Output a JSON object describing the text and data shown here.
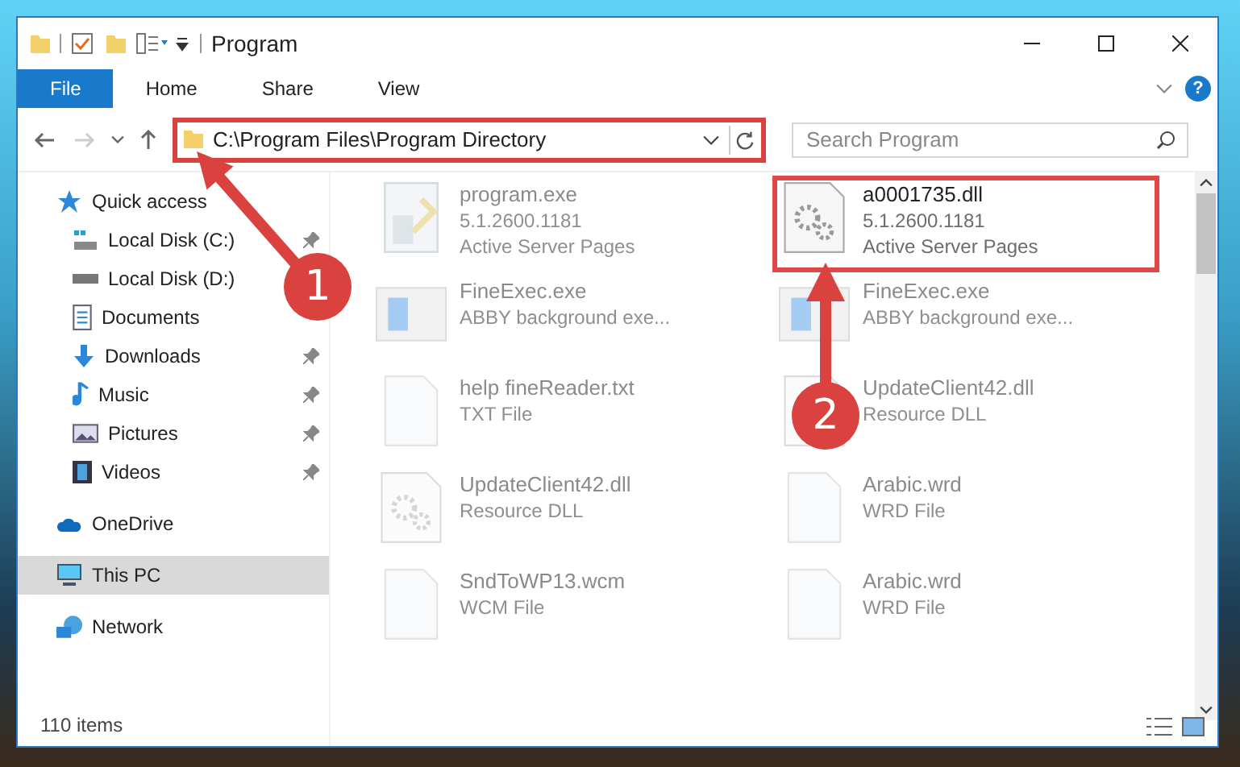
{
  "window": {
    "title": "Program"
  },
  "ribbon_tabs": [
    {
      "label": "File",
      "selected": true
    },
    {
      "label": "Home",
      "selected": false
    },
    {
      "label": "Share",
      "selected": false
    },
    {
      "label": "View",
      "selected": false
    }
  ],
  "help": "?",
  "address": {
    "path": "C:\\Program Files\\Program Directory",
    "highlighted": true
  },
  "search": {
    "placeholder": "Search Program"
  },
  "sidebar": {
    "items": [
      {
        "label": "Quick access",
        "kind": "star",
        "selected": false,
        "children": [
          {
            "label": "Local Disk (C:)",
            "kind": "drive-win",
            "pinned": true
          },
          {
            "label": "Local Disk (D:)",
            "kind": "drive"
          },
          {
            "label": "Documents",
            "kind": "documents",
            "pinned": false
          },
          {
            "label": "Downloads",
            "kind": "download",
            "pinned": true
          },
          {
            "label": "Music",
            "kind": "music",
            "pinned": true
          },
          {
            "label": "Pictures",
            "kind": "pictures",
            "pinned": true
          },
          {
            "label": "Videos",
            "kind": "videos",
            "pinned": true
          }
        ]
      },
      {
        "label": "OneDrive",
        "kind": "cloud",
        "selected": false
      },
      {
        "label": "This PC",
        "kind": "pc",
        "selected": true
      },
      {
        "label": "Network",
        "kind": "network",
        "selected": false
      }
    ]
  },
  "files": [
    [
      {
        "name": "program.exe",
        "details": [
          "5.1.2600.1181",
          "Active Server Pages"
        ],
        "kind": "program",
        "dimmed": true,
        "highlighted": false
      },
      {
        "name": "FineExec.exe",
        "details": [
          "ABBY background exe..."
        ],
        "kind": "app",
        "dimmed": true,
        "highlighted": false
      },
      {
        "name": "help fineReader.txt",
        "details": [
          "TXT File"
        ],
        "kind": "blank",
        "dimmed": true,
        "highlighted": false
      },
      {
        "name": "UpdateClient42.dll",
        "details": [
          "Resource DLL"
        ],
        "kind": "library",
        "dimmed": true,
        "highlighted": false
      },
      {
        "name": "SndToWP13.wcm",
        "details": [
          "WCM File"
        ],
        "kind": "blank",
        "dimmed": true,
        "highlighted": false
      }
    ],
    [
      {
        "name": "a0001735.dll",
        "details": [
          "5.1.2600.1181",
          "Active Server Pages"
        ],
        "kind": "library",
        "dimmed": false,
        "highlighted": true
      },
      {
        "name": "FineExec.exe",
        "details": [
          "ABBY background exe..."
        ],
        "kind": "app",
        "dimmed": true,
        "highlighted": false
      },
      {
        "name": "UpdateClient42.dll",
        "details": [
          "Resource DLL"
        ],
        "kind": "library",
        "dimmed": true,
        "highlighted": false
      },
      {
        "name": "Arabic.wrd",
        "details": [
          "WRD File"
        ],
        "kind": "blank",
        "dimmed": true,
        "highlighted": false
      },
      {
        "name": "Arabic.wrd",
        "details": [
          "WRD File"
        ],
        "kind": "blank",
        "dimmed": true,
        "highlighted": false
      }
    ]
  ],
  "status_bar": {
    "count": "110 items"
  },
  "callouts": [
    {
      "label": "1"
    },
    {
      "label": "2"
    }
  ]
}
